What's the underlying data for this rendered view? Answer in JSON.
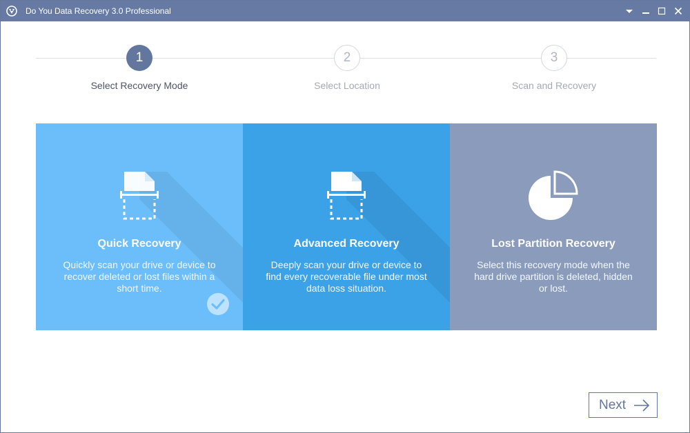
{
  "window": {
    "title": "Do You Data Recovery 3.0 Professional",
    "controls": [
      "chevron-down-icon",
      "minimize-icon",
      "maximize-icon",
      "close-icon"
    ]
  },
  "steps": [
    {
      "number": "1",
      "label": "Select Recovery Mode",
      "state": "active"
    },
    {
      "number": "2",
      "label": "Select Location",
      "state": "inactive"
    },
    {
      "number": "3",
      "label": "Scan and Recovery",
      "state": "inactive"
    }
  ],
  "modes": [
    {
      "title": "Quick Recovery",
      "description": "Quickly scan your drive or device to recover deleted or lost files within a short time.",
      "icon": "document-scan-icon",
      "selected": true,
      "color": "#6cbefa"
    },
    {
      "title": "Advanced Recovery",
      "description": "Deeply scan your drive or device to find every recoverable file under most data loss situation.",
      "icon": "document-scan-icon",
      "selected": false,
      "color": "#3ca2e8"
    },
    {
      "title": "Lost Partition Recovery",
      "description": "Select this recovery mode when the hard drive partition is deleted, hidden or lost.",
      "icon": "pie-chart-icon",
      "selected": false,
      "color": "#8b9bbb"
    }
  ],
  "footer": {
    "next_label": "Next",
    "next_icon": "arrow-right-icon"
  },
  "colors": {
    "titlebar": "#667aa3",
    "accent": "#62769e"
  }
}
